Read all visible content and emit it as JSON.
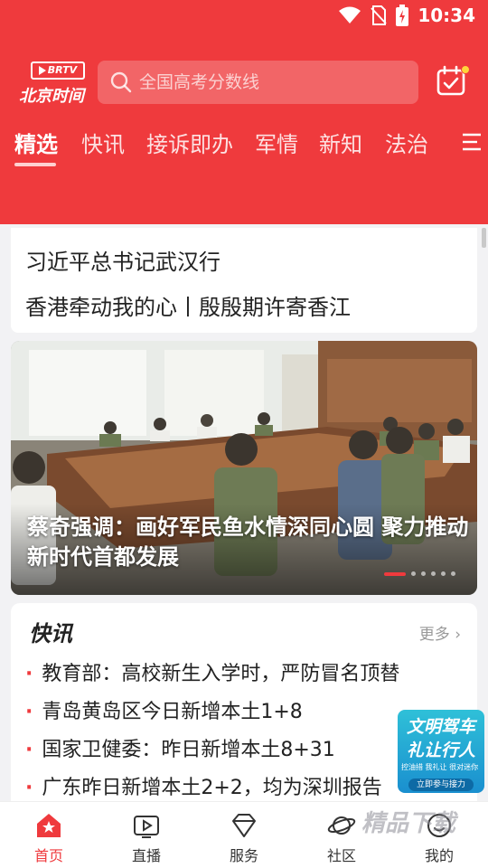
{
  "status_bar": {
    "time": "10:34"
  },
  "header": {
    "logo_badge": "BRTV",
    "logo_text": "北京时间",
    "search_placeholder": "全国高考分数线",
    "accent_color": "#ef3a3d"
  },
  "tabs": [
    {
      "label": "精选",
      "active": true
    },
    {
      "label": "快讯"
    },
    {
      "label": "接诉即办"
    },
    {
      "label": "军情"
    },
    {
      "label": "新知"
    },
    {
      "label": "法治"
    }
  ],
  "headlines": [
    "习近平总书记武汉行",
    "香港牵动我的心丨殷殷期许寄香江"
  ],
  "carousel": {
    "caption": "蔡奇强调：画好军民鱼水情深同心圆 聚力推动新时代首都发展",
    "slide_count": 6,
    "current_slide": 1
  },
  "flash_news": {
    "title": "快讯",
    "more_label": "更多",
    "items": [
      "教育部：高校新生入学时，严防冒名顶替",
      "青岛黄岛区今日新增本土1+8",
      "国家卫健委：昨日新增本土8+31",
      "广东昨日新增本土2+2，均为深圳报告"
    ]
  },
  "floating_ad": {
    "line1": "文明驾车",
    "line2": "礼让行人",
    "small_text": "控油措 我礼让 很对迷你",
    "button": "立即参与接力"
  },
  "bottom_nav": [
    {
      "label": "首页",
      "icon": "home-star-icon",
      "active": true
    },
    {
      "label": "直播",
      "icon": "live-tv-icon"
    },
    {
      "label": "服务",
      "icon": "diamond-icon"
    },
    {
      "label": "社区",
      "icon": "planet-icon"
    },
    {
      "label": "我的",
      "icon": "profile-icon"
    }
  ],
  "watermark": "精品下载"
}
